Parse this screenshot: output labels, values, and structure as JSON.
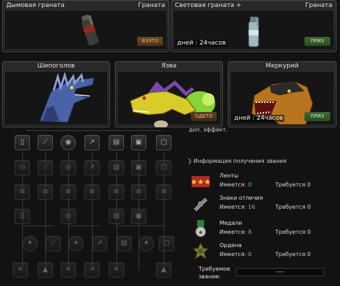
{
  "items": [
    {
      "name": "Дымовая граната",
      "category": "Граната",
      "status": "ВЗЯТО",
      "duration": ""
    },
    {
      "name": "Световая граната +",
      "category": "Граната",
      "status": "ПРИЗ",
      "duration": "дней : 24часов"
    }
  ],
  "characters": [
    {
      "name": "Шипоголов",
      "status": "",
      "duration": ""
    },
    {
      "name": "Язва",
      "status": "ОДЕТО",
      "duration": ""
    },
    {
      "name": "Меркурий",
      "status": "ПРИЗ",
      "duration": "дней : 24часов"
    }
  ],
  "additional_effect": "доп. эффект.",
  "rank_info": {
    "header": "Информация получения звания",
    "have_label": "Имеется:",
    "need_label": "Требуется",
    "rows": [
      {
        "title": "Ленты",
        "have": "0",
        "need": "0",
        "icon": "ribbon-icon"
      },
      {
        "title": "Знаки отличия",
        "have": "16",
        "need": "0",
        "icon": "insignia-icon"
      },
      {
        "title": "Медали",
        "have": "8",
        "need": "0",
        "icon": "medal-icon"
      },
      {
        "title": "Ордена",
        "have": "0",
        "need": "0",
        "icon": "order-icon"
      }
    ],
    "required_label_1": "Требуемое",
    "required_label_2": "звание:",
    "required_value": "----"
  },
  "colors": {
    "accent_blue": "#4a86d8",
    "have_green": "#5fd05f",
    "prize_green": "#3f6a34"
  }
}
